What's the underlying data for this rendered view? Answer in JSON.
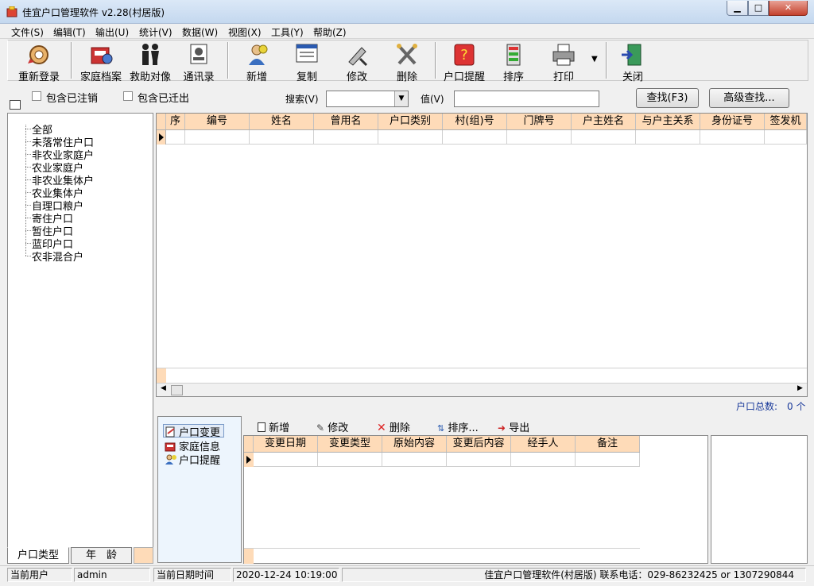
{
  "window": {
    "title": "佳宜户口管理软件 v2.28(村居版)",
    "controls": {
      "minimize": "▁",
      "maximize": "□",
      "close": "✕"
    }
  },
  "menu": [
    "文件(S)",
    "编辑(T)",
    "输出(U)",
    "统计(V)",
    "数据(W)",
    "视图(X)",
    "工具(Y)",
    "帮助(Z)"
  ],
  "toolbar": {
    "items": [
      {
        "label": "重新登录",
        "icon": "relogin-icon"
      },
      {
        "label": "家庭档案",
        "icon": "family-archive-icon"
      },
      {
        "label": "救助对像",
        "icon": "people-icon"
      },
      {
        "label": "通讯录",
        "icon": "address-book-icon"
      },
      {
        "label": "新增",
        "icon": "add-icon"
      },
      {
        "label": "复制",
        "icon": "copy-icon"
      },
      {
        "label": "修改",
        "icon": "edit-icon"
      },
      {
        "label": "删除",
        "icon": "delete-icon"
      },
      {
        "label": "户口提醒",
        "icon": "reminder-icon"
      },
      {
        "label": "排序",
        "icon": "sort-icon"
      },
      {
        "label": "打印",
        "icon": "print-icon"
      },
      {
        "label": "关闭",
        "icon": "close-door-icon"
      }
    ],
    "dropdown": "▼"
  },
  "filter": {
    "include_cancelled": "包含已注销",
    "include_moved_out": "包含已迁出",
    "search_label": "搜索(V)",
    "value_label": "值(V)",
    "find_button": "查找(F3)",
    "advanced_button": "高级查找..."
  },
  "tree": {
    "items": [
      "全部",
      "未落常住户口",
      "非农业家庭户",
      "农业家庭户",
      "非农业集体户",
      "农业集体户",
      "自理口粮户",
      "寄住户口",
      "暂住户口",
      "蓝印户口",
      "农非混合户"
    ],
    "tabs": [
      "户口类型",
      "年　龄"
    ]
  },
  "grid": {
    "columns": [
      "序",
      "编号",
      "姓名",
      "曾用名",
      "户口类别",
      "村(组)号",
      "门牌号",
      "户主姓名",
      "与户主关系",
      "身份证号",
      "签发机"
    ]
  },
  "total": {
    "label": "户口总数:",
    "value": "0 个"
  },
  "bottom_nav": {
    "items": [
      "户口变更",
      "家庭信息",
      "户口提醒"
    ]
  },
  "sub_toolbar": {
    "add": "新增",
    "edit": "修改",
    "delete": "删除",
    "sort": "排序...",
    "export": "导出"
  },
  "sub_grid": {
    "columns": [
      "变更日期",
      "变更类型",
      "原始内容",
      "变更后内容",
      "经手人",
      "备注"
    ]
  },
  "status": {
    "user_label": "当前用户",
    "user_value": "admin",
    "datetime_label": "当前日期时间",
    "datetime_value": "2020-12-24 10:19:00",
    "info": "佳宜户口管理软件(村居版) 联系电话：029-86232425 or 1307290844"
  },
  "colors": {
    "grid_header": "#fedbb8",
    "nav_bg": "#edf5fd",
    "total_text": "#1a3a9a"
  }
}
